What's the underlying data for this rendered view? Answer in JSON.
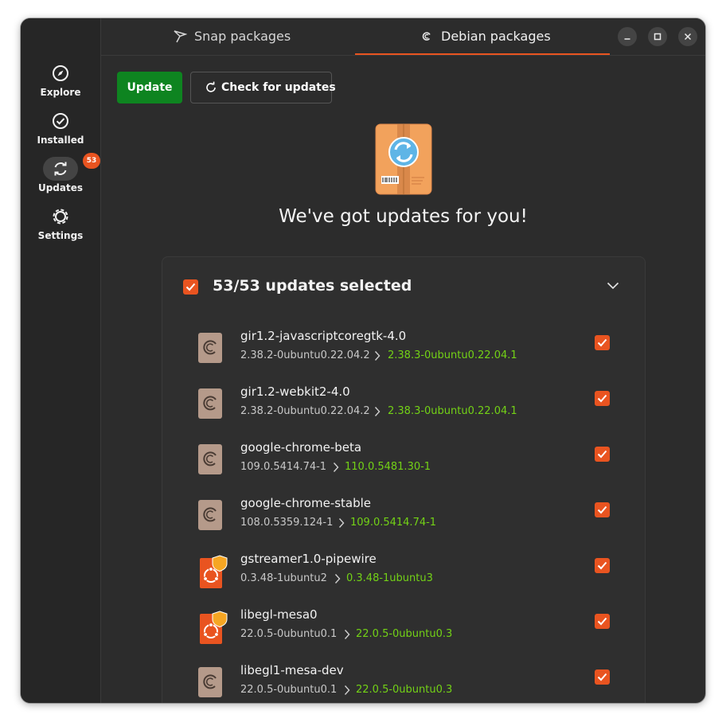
{
  "sidebar": {
    "items": [
      {
        "label": "Explore",
        "icon": "compass-icon"
      },
      {
        "label": "Installed",
        "icon": "check-circle-icon"
      },
      {
        "label": "Updates",
        "icon": "refresh-icon",
        "badge": "53",
        "active": true
      },
      {
        "label": "Settings",
        "icon": "gear-icon"
      }
    ]
  },
  "header": {
    "tabs": [
      {
        "label": "Snap packages",
        "icon": "snap-icon"
      },
      {
        "label": "Debian packages",
        "icon": "debian-icon",
        "active": true
      }
    ]
  },
  "toolbar": {
    "update_label": "Update",
    "check_label": "Check for updates"
  },
  "hero": {
    "title": "We've got updates for you!",
    "icon": "package-update-icon"
  },
  "updates": {
    "selected_label": "53/53 updates selected",
    "all_selected": true,
    "items": [
      {
        "name": "gir1.2-javascriptcoregtk-4.0",
        "old_version": "2.38.2-0ubuntu0.22.04.2",
        "new_version": "2.38.3-0ubuntu0.22.04.1",
        "icon": "debian-package-icon",
        "checked": true
      },
      {
        "name": "gir1.2-webkit2-4.0",
        "old_version": "2.38.2-0ubuntu0.22.04.2",
        "new_version": "2.38.3-0ubuntu0.22.04.1",
        "icon": "debian-package-icon",
        "checked": true
      },
      {
        "name": "google-chrome-beta",
        "old_version": "109.0.5414.74-1",
        "new_version": "110.0.5481.30-1",
        "icon": "debian-package-icon",
        "checked": true
      },
      {
        "name": "google-chrome-stable",
        "old_version": "108.0.5359.124-1",
        "new_version": "109.0.5414.74-1",
        "icon": "debian-package-icon",
        "checked": true
      },
      {
        "name": "gstreamer1.0-pipewire",
        "old_version": "0.3.48-1ubuntu2",
        "new_version": "0.3.48-1ubuntu3",
        "icon": "ubuntu-security-icon",
        "checked": true
      },
      {
        "name": "libegl-mesa0",
        "old_version": "22.0.5-0ubuntu0.1",
        "new_version": "22.0.5-0ubuntu0.3",
        "icon": "ubuntu-security-icon",
        "checked": true
      },
      {
        "name": "libegl1-mesa-dev",
        "old_version": "22.0.5-0ubuntu0.1",
        "new_version": "22.0.5-0ubuntu0.3",
        "icon": "debian-package-icon",
        "checked": true
      }
    ]
  },
  "colors": {
    "accent": "#e95420",
    "update_button": "#0e8420",
    "new_version": "#73d216",
    "window_bg": "#2c2c2c"
  }
}
